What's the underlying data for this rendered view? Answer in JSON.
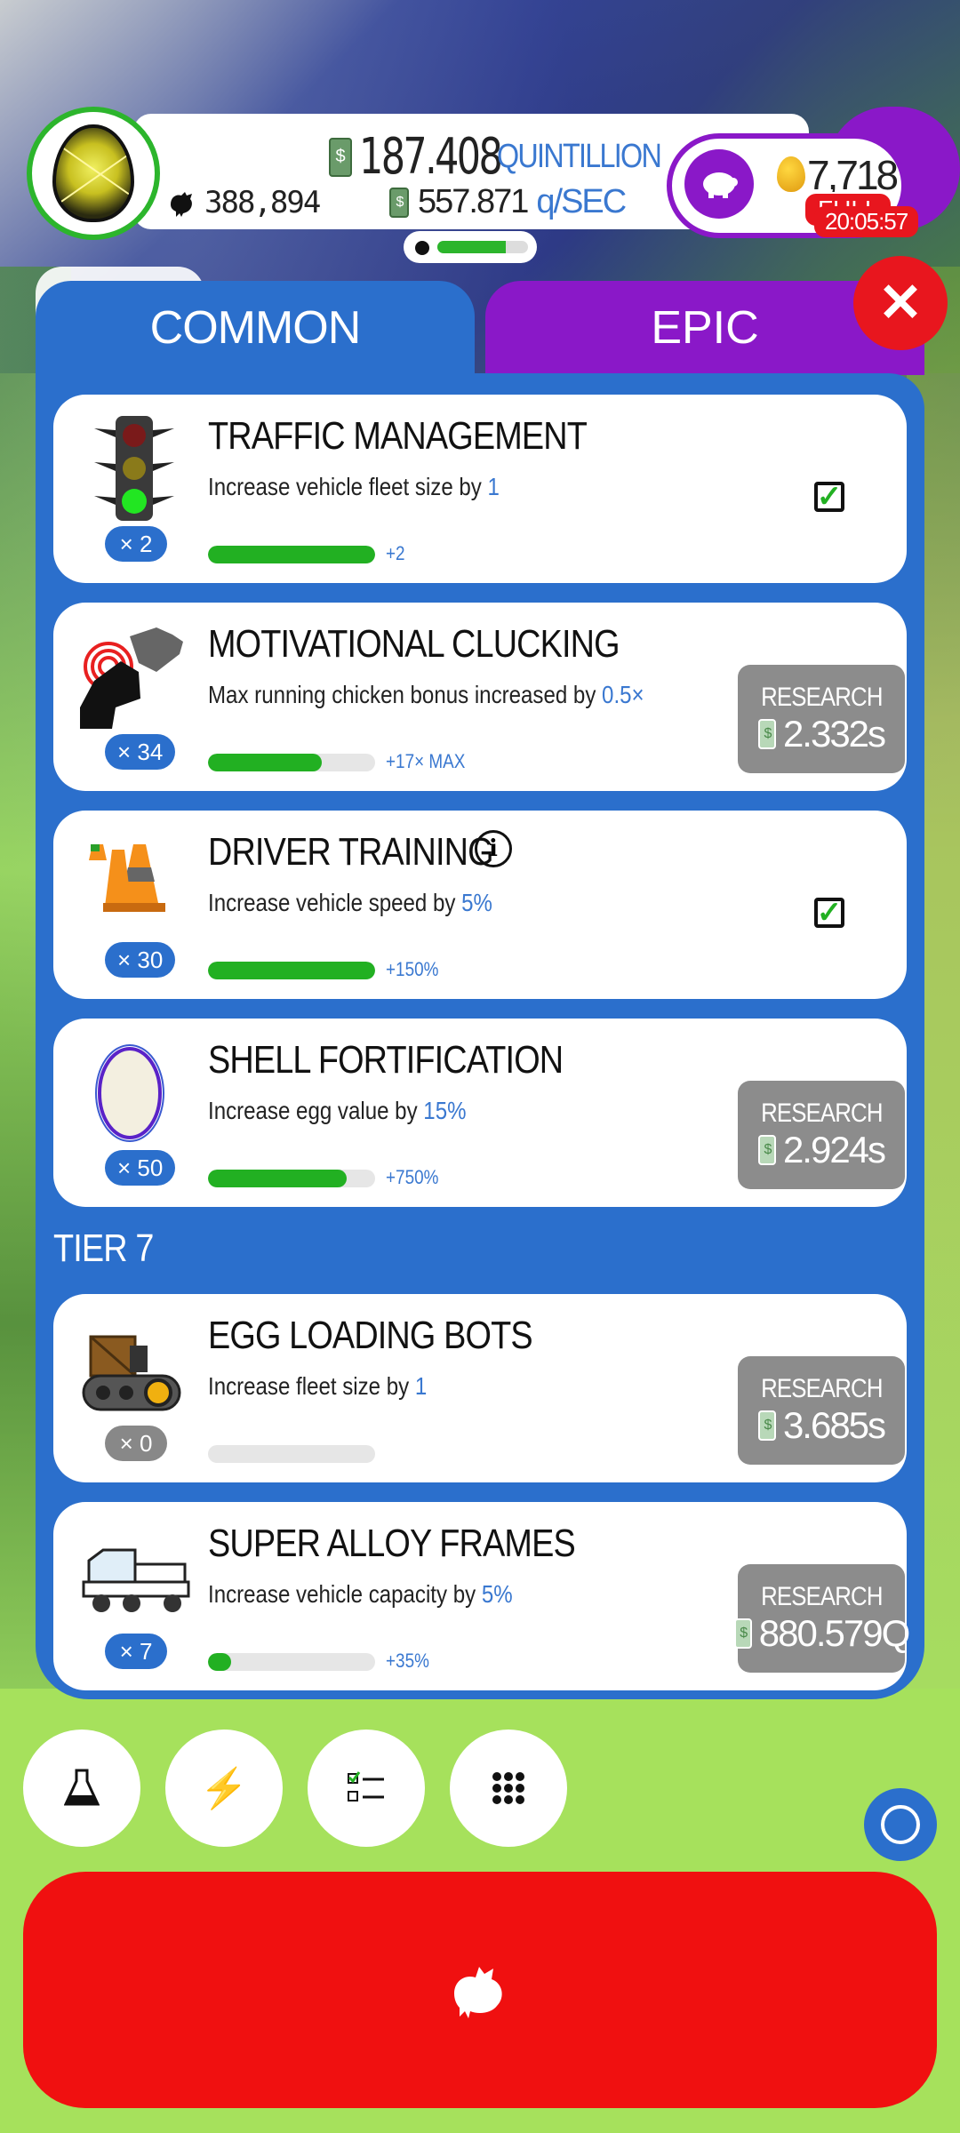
{
  "hud": {
    "chicken_count": "388,894",
    "money_value": "187.408",
    "money_unit": "QUINTILLION",
    "rate_value": "557.871",
    "rate_unit": "q/SEC",
    "golden_eggs": "7,718",
    "piggy_status": "FULL",
    "timer": "20:05:57",
    "hatchery_progress": 0.75
  },
  "tabs": {
    "common": "COMMON",
    "epic": "EPIC"
  },
  "research": [
    {
      "title": "TRAFFIC MANAGEMENT",
      "desc_prefix": "Increase vehicle fleet size by",
      "desc_value": "1",
      "multiplier": "× 2",
      "progress": 1.0,
      "bonus": "+2",
      "state": "complete",
      "icon": "traffic-light-icon"
    },
    {
      "title": "MOTIVATIONAL CLUCKING",
      "desc_prefix": "Max running chicken bonus increased by",
      "desc_value": "0.5×",
      "multiplier": "× 34",
      "progress": 0.68,
      "bonus": "+17× MAX",
      "state": "research",
      "research_label": "RESEARCH",
      "cost": "2.332s",
      "icon": "megaphone-chicken-icon"
    },
    {
      "title": "DRIVER TRAINING",
      "desc_prefix": "Increase vehicle speed by",
      "desc_value": "5%",
      "multiplier": "× 30",
      "progress": 1.0,
      "bonus": "+150%",
      "state": "complete",
      "icon": "traffic-cones-icon"
    },
    {
      "title": "SHELL FORTIFICATION",
      "desc_prefix": "Increase egg value by",
      "desc_value": "15%",
      "multiplier": "× 50",
      "progress": 0.83,
      "bonus": "+750%",
      "state": "research",
      "research_label": "RESEARCH",
      "cost": "2.924s",
      "icon": "egg-icon"
    }
  ],
  "tier_label": "TIER 7",
  "tier7": [
    {
      "title": "EGG LOADING BOTS",
      "desc_prefix": "Increase fleet size by",
      "desc_value": "1",
      "multiplier": "× 0",
      "progress": 0.0,
      "bonus": "",
      "state": "research",
      "research_label": "RESEARCH",
      "cost": "3.685s",
      "icon": "loading-bot-icon"
    },
    {
      "title": "SUPER ALLOY FRAMES",
      "desc_prefix": "Increase vehicle capacity by",
      "desc_value": "5%",
      "multiplier": "× 7",
      "progress": 0.14,
      "bonus": "+35%",
      "state": "research",
      "research_label": "RESEARCH",
      "cost": "880.579Q",
      "icon": "truck-frame-icon"
    }
  ],
  "colors": {
    "primary_blue": "#2b6fcc",
    "epic_purple": "#8a18c8",
    "danger_red": "#e8161e",
    "progress_green": "#22b022",
    "research_grey": "#8c8c8c"
  }
}
